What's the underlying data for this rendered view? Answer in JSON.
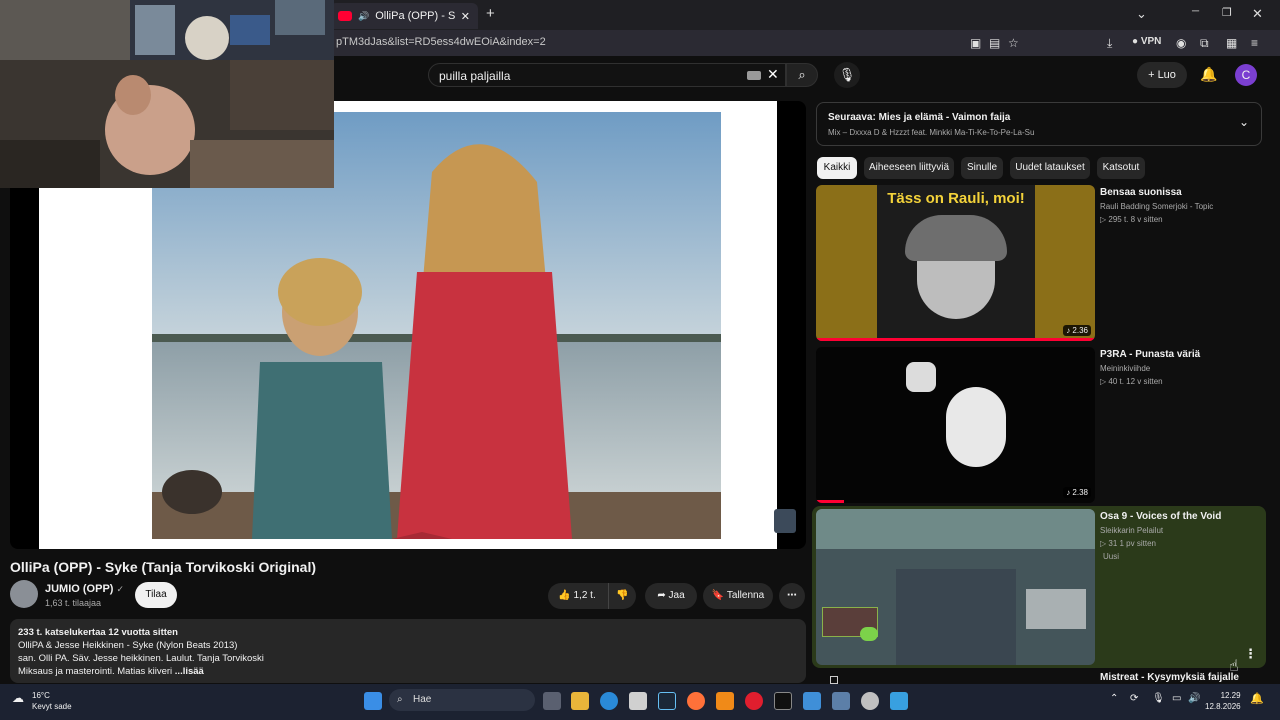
{
  "browser": {
    "tab_title": "OlliPa (OPP) - Syke (Tanja To",
    "url": "pTM3dJas&list=RD5ess4dwEOiA&index=2",
    "vpn_label": "VPN",
    "new_tab": "+",
    "chevron": "⌄",
    "minimize": "─",
    "restore": "❐",
    "close": "✕"
  },
  "header": {
    "search_query": "puilla paljailla",
    "create_label": "Luo",
    "avatar_letter": "C"
  },
  "video": {
    "title": "OlliPa (OPP) - Syke (Tanja Torvikoski Original)",
    "channel": "JUMIO (OPP)",
    "subscribers": "1,63 t. tilaajaa",
    "subscribe_label": "Tilaa",
    "likes": "1,2 t.",
    "share_label": "Jaa",
    "save_label": "Tallenna",
    "description": {
      "meta": "233 t. katselukertaa  12 vuotta sitten",
      "line1": "OlliPA & Jesse Heikkinen - Syke (Nylon Beats 2013)",
      "line2": "san. Olli PA. Säv. Jesse heikkinen. Laulut. Tanja Torvikoski",
      "line3": "Miksaus ja masterointi. Matias kiiveri",
      "more": "...lisää"
    }
  },
  "sidebar": {
    "up_next_title": "Seuraava: Mies ja elämä - Vaimon faija",
    "up_next_sub": "Mix – Dxxxa D & Hzzzt feat. Minkki Ma-Ti-Ke-To-Pe-La-Su",
    "chips": [
      "Kaikki",
      "Aiheeseen liittyviä",
      "Sinulle",
      "Uudet lataukset",
      "Katsotut"
    ],
    "items": [
      {
        "title": "Bensaa suonissa",
        "channel": "Rauli Badding Somerjoki - Topic",
        "meta": "▷ 295 t.  8 v sitten",
        "duration": "♪ 2.36",
        "thumb_text": "Täss on Rauli, moi!"
      },
      {
        "title": "P3RA - Punasta väriä",
        "channel": "Meininkiviihde",
        "meta": "▷ 40 t.  12 v sitten",
        "duration": "♪ 2.38"
      },
      {
        "title": "Osa 9 - Voices of the Void",
        "channel": "Sleikkarin Pelailut",
        "meta": "▷ 31  1 pv sitten",
        "badge": "Uusi"
      },
      {
        "title": "Mistreat - Kysymyksiä faijalle"
      }
    ]
  },
  "taskbar": {
    "temp": "16°C",
    "weather": "Kevyt sade",
    "search_label": "Hae",
    "time": "12.29",
    "date": "12.8.2026"
  },
  "colors": {
    "yt_red": "#ff0033",
    "background": "#0f0f0f",
    "chip_bg": "#272727",
    "taskbar": "#1c2231"
  }
}
